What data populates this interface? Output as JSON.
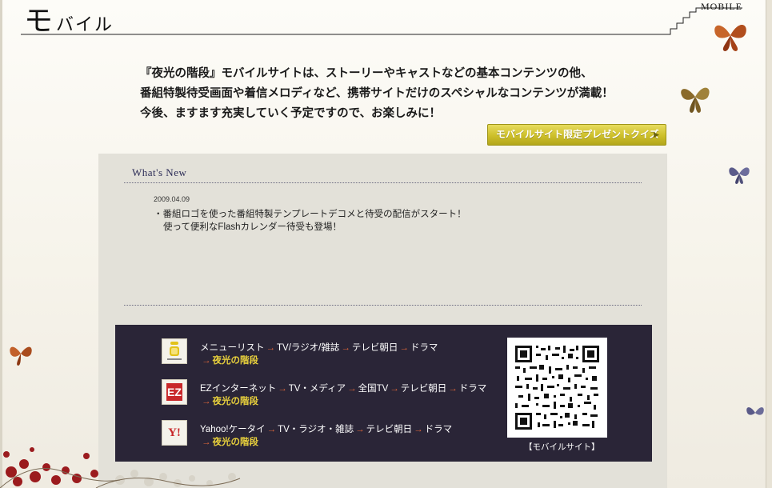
{
  "header": {
    "title_big": "モ",
    "title_small": "バイル",
    "label_en": "MOBILE"
  },
  "intro": {
    "lines": [
      "『夜光の階段』モバイルサイトは、ストーリーやキャストなどの基本コンテンツの他、",
      "番組特製待受画面や着信メロディなど、携帯サイトだけのスペシャルなコンテンツが満載！",
      "今後、ますます充実していく予定ですので、お楽しみに！"
    ],
    "promo_button": "モバイルサイト限定プレゼントクイズ"
  },
  "whats_new": {
    "title": "What's New",
    "items": [
      {
        "date": "2009.04.09",
        "line1": "・番組ロゴを使った番組特製テンプレートデコメと待受の配信がスタート！",
        "line2": "使って便利なFlashカレンダー待受も登場！"
      }
    ]
  },
  "access": {
    "arrow": "→",
    "carriers": [
      {
        "icon": "imode-icon",
        "label": "i-mode",
        "steps": [
          "メニューリスト",
          "TV/ラジオ/雑誌",
          "テレビ朝日",
          "ドラマ"
        ],
        "destination": "夜光の階段"
      },
      {
        "icon": "ezweb-icon",
        "label": "EZ",
        "steps": [
          "EZインターネット",
          "TV・メディア",
          "全国TV",
          "テレビ朝日",
          "ドラマ"
        ],
        "destination": "夜光の階段"
      },
      {
        "icon": "yahoo-keitai-icon",
        "label": "Y!",
        "steps": [
          "Yahoo!ケータイ",
          "TV・ラジオ・雑誌",
          "テレビ朝日",
          "ドラマ"
        ],
        "destination": "夜光の階段"
      }
    ],
    "qr_caption": "【モバイルサイト】"
  },
  "colors": {
    "panel": "#e3e1d9",
    "dark_box": "#2a2537",
    "arrow": "#e1683a",
    "destination": "#e9d13c",
    "button": "#cdbf2a"
  }
}
